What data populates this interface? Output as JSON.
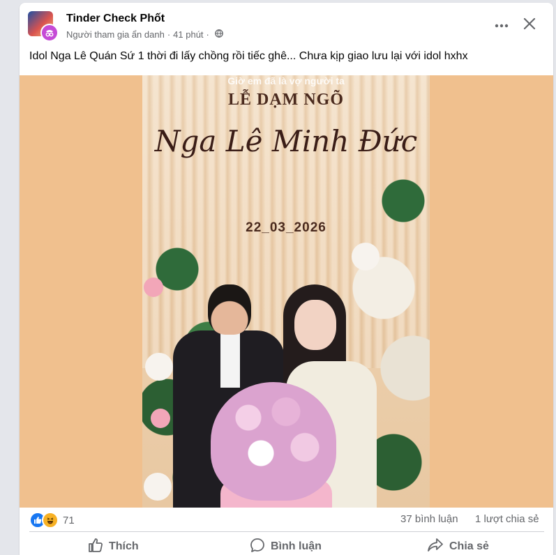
{
  "post": {
    "group_name": "Tinder Check Phốt",
    "author": "Người tham gia ẩn danh",
    "time": "41 phút",
    "caption": "Idol Nga Lê Quán Sứ 1 thời đi lấy chồng rồi tiếc ghê... Chưa kịp giao lưu lại với idol hxhx"
  },
  "photo": {
    "story_text": "Giờ em đã là vợ người ta",
    "event_title": "LỄ DẠM NGÕ",
    "names": "Nga Lê  Minh Đức",
    "date": "22_03_2026"
  },
  "stats": {
    "reaction_count": "71",
    "comments": "37 bình luận",
    "shares": "1 lượt chia sẻ"
  },
  "actions": {
    "like": "Thích",
    "comment": "Bình luận",
    "share": "Chia sẻ"
  },
  "icons": [
    "more-icon",
    "close-icon",
    "globe-icon",
    "like-reaction-icon",
    "haha-reaction-icon",
    "thumbs-up-icon",
    "comment-icon",
    "share-icon"
  ],
  "colors": {
    "accent": "#1877f2",
    "photo_background": "#f0c08e",
    "anon_badge": "#c54bd6"
  }
}
